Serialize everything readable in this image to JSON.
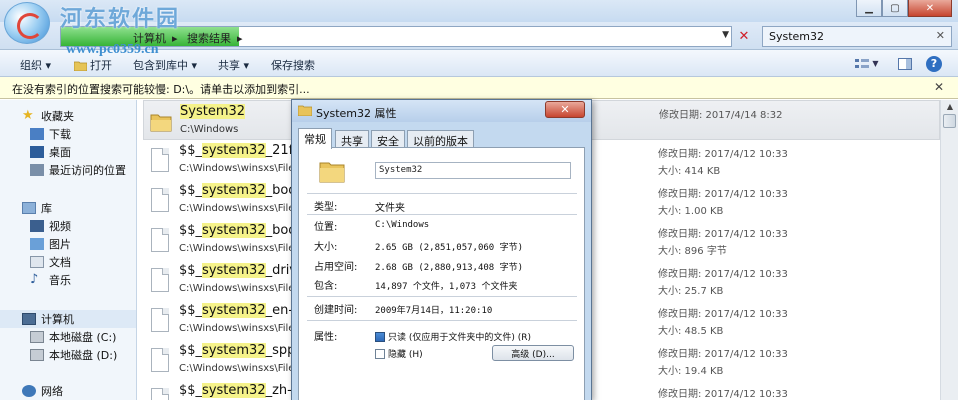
{
  "watermark": {
    "text": "河东软件园",
    "url": "www.pc0359.cn"
  },
  "window": {
    "minimize": "▁",
    "maximize": "▢",
    "close": "✕"
  },
  "address": {
    "crumbs": [
      "计算机",
      "搜索结果"
    ],
    "search_value": "System32",
    "search_clear": "✕"
  },
  "toolbar": {
    "organize": "组织 ▾",
    "open": "打开",
    "include_in_library": "包含到库中 ▾",
    "share": "共享 ▾",
    "save_search": "保存搜索"
  },
  "infobar": {
    "text": "在没有索引的位置搜索可能较慢: D:\\。请单击以添加到索引...",
    "close": "✕"
  },
  "nav": {
    "favorites": {
      "label": "收藏夹",
      "items": [
        "下载",
        "桌面",
        "最近访问的位置"
      ]
    },
    "libraries": {
      "label": "库",
      "items": [
        "视频",
        "图片",
        "文档",
        "音乐"
      ]
    },
    "computer": {
      "label": "计算机",
      "items": [
        "本地磁盘 (C:)",
        "本地磁盘 (D:)"
      ]
    },
    "network": {
      "label": "网络"
    }
  },
  "results": [
    {
      "pre": "",
      "hl": "System32",
      "post": "",
      "path": "C:\\Windows",
      "date": "修改日期: 2017/4/14 8:32",
      "size": "",
      "type": "folder",
      "selected": true
    },
    {
      "pre": "$$_",
      "hl": "system32",
      "post": "_21f9a",
      "path": "C:\\Windows\\winsxs\\FileM",
      "date": "修改日期: 2017/4/12 10:33",
      "size": "大小: 414 KB",
      "type": "file"
    },
    {
      "pre": "$$_",
      "hl": "system32",
      "post": "_boot_",
      "path": "C:\\Windows\\winsxs\\FileM",
      "date": "修改日期: 2017/4/12 10:33",
      "size": "大小: 1.00 KB",
      "type": "file"
    },
    {
      "pre": "$$_",
      "hl": "system32",
      "post": "_boot_",
      "path": "C:\\Windows\\winsxs\\FileM",
      "date": "修改日期: 2017/4/12 10:33",
      "size": "大小: 896 字节",
      "type": "file"
    },
    {
      "pre": "$$_",
      "hl": "system32",
      "post": "_drive",
      "path": "C:\\Windows\\winsxs\\FileM",
      "date": "修改日期: 2017/4/12 10:33",
      "size": "大小: 25.7 KB",
      "type": "file"
    },
    {
      "pre": "$$_",
      "hl": "system32",
      "post": "_en-us",
      "path": "C:\\Windows\\winsxs\\FileM",
      "date": "修改日期: 2017/4/12 10:33",
      "size": "大小: 48.5 KB",
      "type": "file"
    },
    {
      "pre": "$$_",
      "hl": "system32",
      "post": "_spp_t",
      "path": "C:\\Windows\\winsxs\\FileM",
      "date": "修改日期: 2017/4/12 10:33",
      "size": "大小: 19.4 KB",
      "type": "file"
    },
    {
      "pre": "$$_",
      "hl": "system32",
      "post": "_zh-cn",
      "path": "",
      "date": "修改日期: 2017/4/12 10:33",
      "size": "",
      "type": "file"
    }
  ],
  "dialog": {
    "title": "System32 属性",
    "close": "✕",
    "tabs": [
      "常规",
      "共享",
      "安全",
      "以前的版本"
    ],
    "name": "System32",
    "props": [
      {
        "label": "类型:",
        "value": "文件夹"
      },
      {
        "label": "位置:",
        "value": "C:\\Windows"
      },
      {
        "label": "大小:",
        "value": "2.65 GB (2,851,057,060 字节)"
      },
      {
        "label": "占用空间:",
        "value": "2.68 GB (2,880,913,408 字节)"
      },
      {
        "label": "包含:",
        "value": "14,897 个文件，1,073 个文件夹"
      },
      {
        "label": "创建时间:",
        "value": "2009年7月14日，11:20:10"
      },
      {
        "label": "属性:",
        "value": ""
      }
    ],
    "readonly_label": "只读 (仅应用于文件夹中的文件) (R)",
    "hidden_label": "隐藏 (H)",
    "advanced": "高级 (D)..."
  }
}
